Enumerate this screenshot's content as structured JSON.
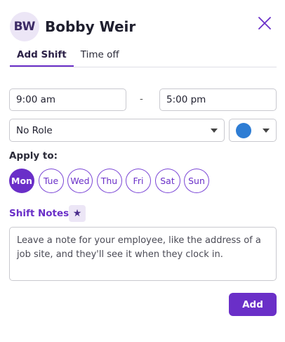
{
  "employee": {
    "initials": "BW",
    "name": "Bobby Weir"
  },
  "close_icon": "close-icon",
  "tabs": [
    {
      "label": "Add Shift",
      "active": true
    },
    {
      "label": "Time off",
      "active": false
    }
  ],
  "shift": {
    "start_time": "9:00 am",
    "separator": "-",
    "end_time": "5:00 pm",
    "role": "No Role",
    "color": "#2e7dd4"
  },
  "apply_to": {
    "label": "Apply to:",
    "days": [
      {
        "label": "Mon",
        "selected": true
      },
      {
        "label": "Tue",
        "selected": false
      },
      {
        "label": "Wed",
        "selected": false
      },
      {
        "label": "Thu",
        "selected": false
      },
      {
        "label": "Fri",
        "selected": false
      },
      {
        "label": "Sat",
        "selected": false
      },
      {
        "label": "Sun",
        "selected": false
      }
    ]
  },
  "notes": {
    "label": "Shift Notes:",
    "star_icon": "star-icon",
    "placeholder": "Leave a note for your employee, like the address of a job site, and they'll see it when they clock in."
  },
  "actions": {
    "add_label": "Add"
  },
  "colors": {
    "accent": "#6a2fc8",
    "avatar_bg": "#ece6f6"
  }
}
